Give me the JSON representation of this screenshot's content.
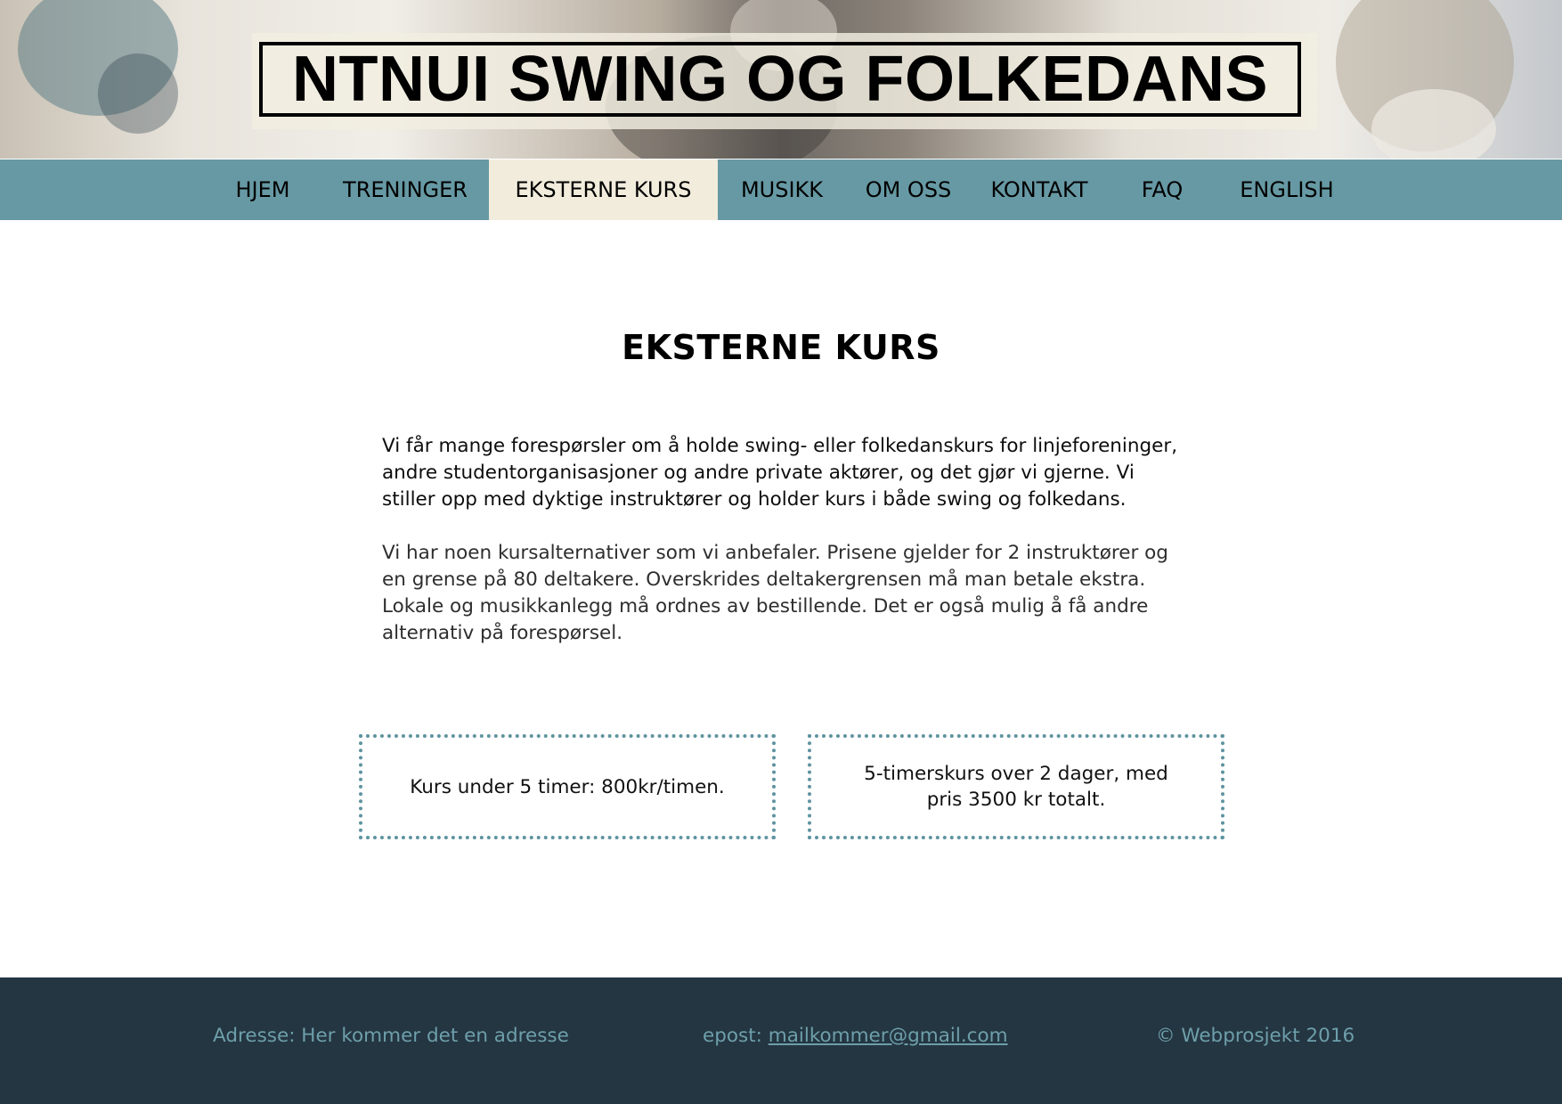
{
  "header": {
    "site_title": "NTNUI SWING OG FOLKEDANS"
  },
  "nav": {
    "items": [
      {
        "label": "HJEM"
      },
      {
        "label": "TRENINGER"
      },
      {
        "label": "EKSTERNE KURS",
        "active": true
      },
      {
        "label": "MUSIKK"
      },
      {
        "label": "OM OSS"
      },
      {
        "label": "KONTAKT"
      },
      {
        "label": "FAQ"
      },
      {
        "label": "ENGLISH"
      }
    ]
  },
  "main": {
    "title": "EKSTERNE KURS",
    "paragraph1": "Vi får mange forespørsler om å holde swing- eller folkedanskurs for linjeforeninger, andre studentorganisasjoner og andre private aktører, og det gjør vi gjerne. Vi stiller opp med dyktige instruktører og holder kurs i både swing og folkedans.",
    "paragraph2": "Vi har noen kursalternativer som vi anbefaler. Prisene gjelder for 2 instruktører og en grense på 80 deltakere. Overskrides deltakergrensen må man betale ekstra. Lokale og musikkanlegg må ordnes av bestillende. Det er også mulig å få andre alternativ på forespørsel.",
    "cards": [
      {
        "text": "Kurs under 5 timer: 800kr/timen."
      },
      {
        "text": "5-timerskurs over 2 dager, med pris 3500 kr totalt."
      }
    ]
  },
  "footer": {
    "address": "Adresse: Her kommer det en adresse",
    "email_label": "epost: ",
    "email": "mailkommer@gmail.com",
    "copyright": "© Webprosjekt 2016"
  },
  "colors": {
    "nav_bg": "#6699a4",
    "nav_active_bg": "#f1ecdc",
    "footer_bg": "#243642",
    "footer_text": "#6d9faa",
    "card_border": "#5f93a0"
  }
}
